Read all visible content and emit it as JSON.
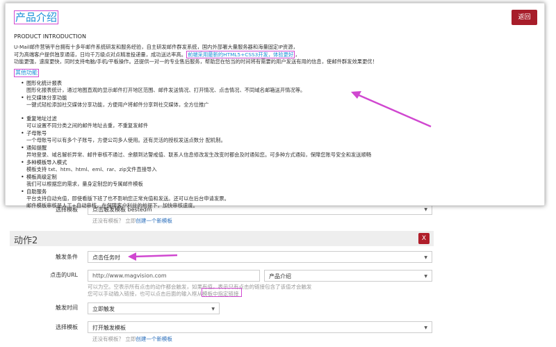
{
  "modal": {
    "title": "产品介绍",
    "back_label": "返回",
    "subtitle": "PRODUCT INTRODUCTION",
    "desc_line1": "U-Mail邮件营销平台拥有十多年邮件系统研发和服务经验，自主研发邮件群发系统，国内外部署大量服务器和海量固定IP资源，",
    "desc_line2_a": "可为高端客户提供独享通道，日均千万级点对点精准投递量，成功送达率高。",
    "desc_line2_hl": "前端采用最新的HTML5+CSS3开发，体验更好",
    "desc_line2_b": "，",
    "desc_line3": "功能更强，速度更快，同时支持电脑/手机/平板操作。还提供一对一的专业售后服务，帮助您在恰当的时间将有需要的用户发送有用的信息，使邮件群发效果更优！",
    "features_title": "其他功能",
    "features": [
      {
        "title": "图形化统计报表",
        "desc": "图形化报表统计，通过地图直观的显示邮件打开地区范围、邮件发送情况、打开情况、点击情况、不同域名邮箱送开情况等。"
      },
      {
        "title": "社交媒体分享功能",
        "desc": "一键式轻松添加社交媒体分享功能，方便用户将邮件分享到社交媒体，全方位推广"
      },
      {
        "title": "重复地址过滤",
        "desc": "可以设置不同分类之间的邮件地址去重，不重复发邮件"
      },
      {
        "title": "子母账号",
        "desc": "一个母账号可以有多个子账号，方便公司多人使用。还有灵活的授权发送点数分 配机制。"
      },
      {
        "title": "通知提醒",
        "desc": "异地登录、域名解析异常、邮件审核不通过、余额到达警戒值、联系人信息修改发生改变时都会及时通知您。可多种方式通知，保障您账号安全和发送顺畅"
      },
      {
        "title": "多种模板导入模式",
        "desc": "模板支持 txt、htm、html、eml、rar、zip文件直接导入"
      },
      {
        "title": "模板高级定制",
        "desc": "我们可以根据您的需求，量身定制您的专属邮件模板"
      },
      {
        "title": "自助服务",
        "desc": "平台支持自动充值，即使看版下班了也不影响您正常充值和发送。还可以在后台申请发票。",
        "desc2": "邮件模板审核是人工+自动审核，在保障客户利益的前提下，加快审核速度。"
      }
    ]
  },
  "form": {
    "choose_template_label_top": "选择模板",
    "select_top_value": "点击触发模板 bestedm",
    "hint_top_text": "还没有模板？ 立即",
    "hint_top_link": "创建一个新模板",
    "section_title": "动作2",
    "section_close": "X",
    "trigger_label": "触发条件",
    "trigger_value": "点击任务时",
    "url_label": "点击的URL",
    "url_value": "http://www.magvision.com",
    "url_select_value": "产品介绍",
    "url_hint_line1": "可以为空。空表示所有点击的动作都会触发，如果有值，表示只有点击的链接包含了该值才会触发",
    "url_hint_line2_a": "您可以手动输入链接，也可以点击后面的输入框从",
    "url_hint_line2_hl": "模板中指定链接",
    "time_label": "触发时间",
    "time_value": "立即触发",
    "choose_template_label": "选择模板",
    "choose_template_value": "打开触发模板",
    "hint_bottom_text": "还没有模板？ 立即",
    "hint_bottom_link": "创建一个新模板"
  },
  "colors": {
    "accent": "#1a8fd8",
    "danger": "#a71d2a",
    "annotation": "#d047d0"
  }
}
